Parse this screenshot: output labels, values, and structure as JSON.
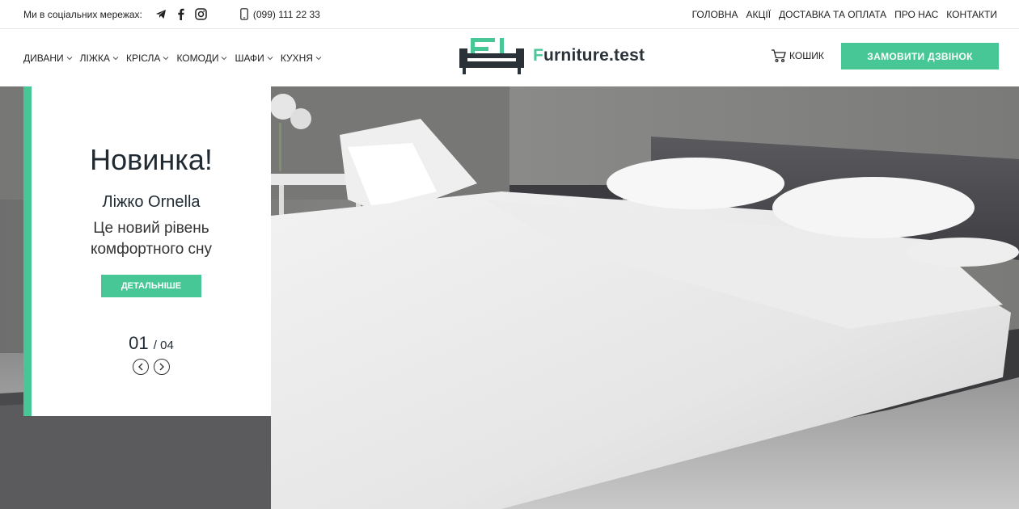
{
  "topbar": {
    "social_label": "Ми в соціальних мережах:",
    "social_icons": [
      "telegram-icon",
      "facebook-icon",
      "instagram-icon"
    ],
    "phone": "(099) 111 22 33",
    "nav": [
      "ГОЛОВНА",
      "АКЦІЇ",
      "ДОСТАВКА ТА ОПЛАТА",
      "ПРО НАС",
      "КОНТАКТИ"
    ]
  },
  "header": {
    "menu": [
      "ДИВАНИ",
      "ЛІЖКА",
      "КРІСЛА",
      "КОМОДИ",
      "ШАФИ",
      "КУХНЯ"
    ],
    "logo_first_letter": "F",
    "logo_rest": "urniture.test",
    "cart_label": "КОШИК",
    "call_button": "ЗАМОВИТИ ДЗВІНОК"
  },
  "hero": {
    "title": "Новинка!",
    "subtitle": "Ліжко Ornella",
    "description": "Це новий рівень комфортного сну",
    "button": "ДЕТАЛЬНІШЕ",
    "current": "01",
    "total": "/ 04"
  },
  "colors": {
    "accent": "#47c796",
    "text": "#1f2a33"
  }
}
